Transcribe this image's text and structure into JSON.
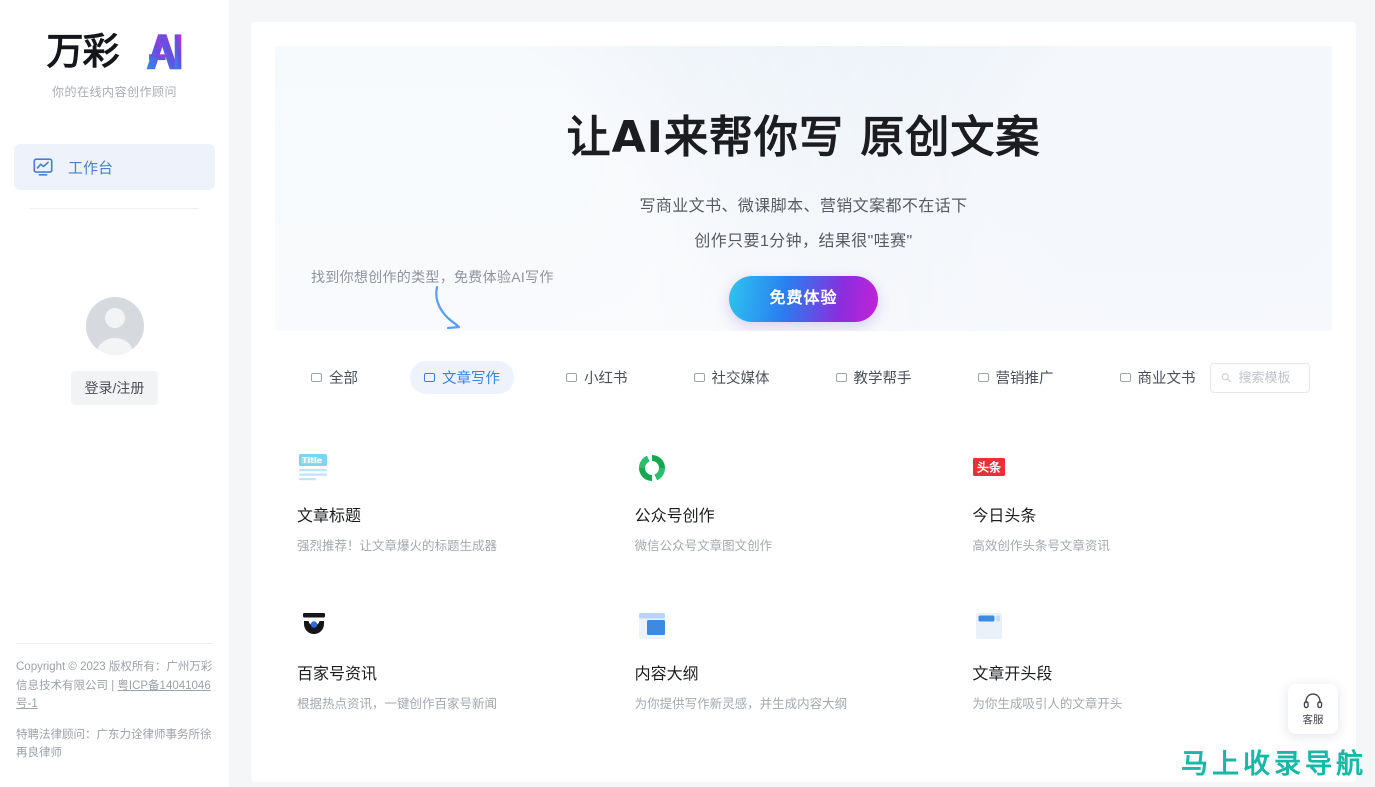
{
  "sidebar": {
    "brand_cn": "万彩",
    "brand_ai_icon": "ai-logo-icon",
    "tagline": "你的在线内容创作顾问",
    "nav": [
      {
        "label": "工作台",
        "icon": "dashboard-icon",
        "active": true
      }
    ],
    "user": {
      "avatar_icon": "user-avatar-icon",
      "login_label": "登录/注册"
    },
    "footer": {
      "copyright_line": "Copyright © 2023 版权所有：广州万彩信息技术有限公司 | ",
      "icp_link": "粤ICP备14041046号-1",
      "legal_line": "特聘法律顾问：广东力诠律师事务所徐再良律师"
    }
  },
  "hero": {
    "title": "让AI来帮你写 原创文案",
    "subtitle_1": "写商业文书、微课脚本、营销文案都不在话下",
    "subtitle_2": "创作只要1分钟，结果很\"哇赛\"",
    "cta_label": "免费体验",
    "cta_gradient_from": "#2ec5ef",
    "cta_gradient_to": "#c622d6"
  },
  "hint": {
    "text": "找到你想创作的类型，免费体验AI写作",
    "arrow_icon": "curved-arrow-icon",
    "arrow_color": "#5a9ff0"
  },
  "filters": {
    "items": [
      {
        "label": "全部",
        "active": false
      },
      {
        "label": "文章写作",
        "active": true
      },
      {
        "label": "小红书",
        "active": false
      },
      {
        "label": "社交媒体",
        "active": false
      },
      {
        "label": "教学帮手",
        "active": false
      },
      {
        "label": "营销推广",
        "active": false
      },
      {
        "label": "商业文书",
        "active": false
      }
    ],
    "active_color": "#3b82e6"
  },
  "search": {
    "icon": "search-icon",
    "placeholder": "搜索模板",
    "value": ""
  },
  "templates": [
    {
      "icon": "title-doc-icon",
      "title": "文章标题",
      "desc": "强烈推荐！让文章爆火的标题生成器"
    },
    {
      "icon": "wechat-official-icon",
      "title": "公众号创作",
      "desc": "微信公众号文章图文创作"
    },
    {
      "icon": "toutiao-icon",
      "title": "今日头条",
      "desc": "高效创作头条号文章资讯"
    },
    {
      "icon": "baijiahao-icon",
      "title": "百家号资讯",
      "desc": "根据热点资讯，一键创作百家号新闻"
    },
    {
      "icon": "outline-icon",
      "title": "内容大纲",
      "desc": "为你提供写作新灵感，并生成内容大纲"
    },
    {
      "icon": "opening-paragraph-icon",
      "title": "文章开头段",
      "desc": "为你生成吸引人的文章开头"
    }
  ],
  "support": {
    "icon": "headset-icon",
    "label": "客服"
  },
  "watermark": {
    "text": "马上收录导航",
    "color": "#19b8a6"
  }
}
